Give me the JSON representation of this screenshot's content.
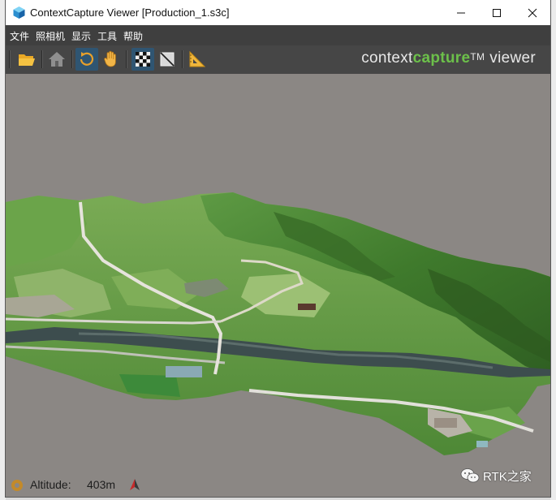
{
  "window": {
    "title": "ContextCapture Viewer [Production_1.s3c]",
    "app_icon": "contextcapture-cube-icon"
  },
  "title_buttons": [
    {
      "name": "minimize-button",
      "icon": "minimize-icon"
    },
    {
      "name": "maximize-button",
      "icon": "maximize-icon"
    },
    {
      "name": "close-button",
      "icon": "close-icon"
    }
  ],
  "menu": {
    "items": [
      "文件",
      "照相机",
      "显示",
      "工具",
      "帮助"
    ]
  },
  "toolbar": {
    "tools": [
      {
        "name": "open-file-button",
        "icon": "folder-open-icon",
        "active": false
      },
      {
        "name": "home-view-button",
        "icon": "home-icon",
        "active": false
      },
      {
        "name": "orbit-button",
        "icon": "orbit-icon",
        "active": true
      },
      {
        "name": "pan-button",
        "icon": "hand-icon",
        "active": false
      },
      {
        "name": "texture-toggle-button",
        "icon": "checkerboard-icon",
        "active": false
      },
      {
        "name": "wireframe-toggle-button",
        "icon": "wireframe-icon",
        "active": false
      },
      {
        "name": "measure-button",
        "icon": "set-square-icon",
        "active": false
      }
    ]
  },
  "brand": {
    "part1": "context",
    "part2": "capture",
    "tm": "TM",
    "part3": "viewer"
  },
  "status": {
    "altitude_label": "Altitude:",
    "altitude_value": "403m",
    "icons": [
      "compass-icon",
      "north-arrow-icon"
    ]
  },
  "watermark": {
    "text": "RTK之家",
    "icon": "wechat-icon"
  },
  "colors": {
    "viewport_background": "#8b8784",
    "menubar": "#3f3f3f",
    "toolbar": "#464646",
    "brand_accent": "#6cc04a",
    "terrain_green": "#4f8a38",
    "river": "#3d4d4e"
  }
}
